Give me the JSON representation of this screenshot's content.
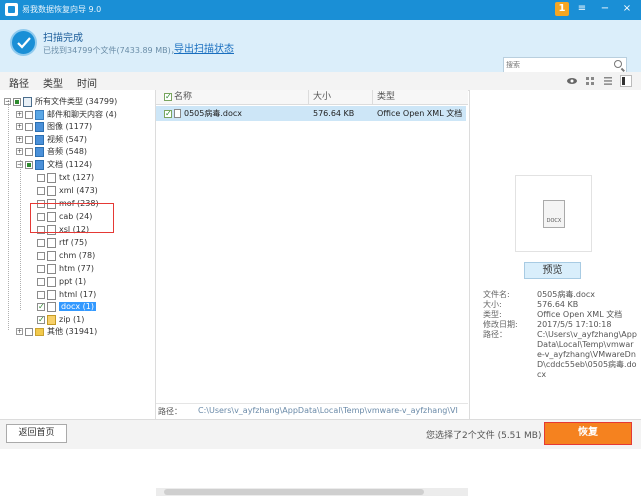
{
  "window": {
    "title": "易我数据恢复向导 9.0",
    "badge": "1"
  },
  "scan": {
    "title": "扫描完成",
    "subtitle": "已找到34799个文件(7433.89 MB)，",
    "export_link": "导出扫描状态",
    "search_placeholder": "搜索"
  },
  "view_tabs": [
    "路径",
    "类型",
    "时间"
  ],
  "tree": [
    {
      "label": "所有文件类型 (34799)",
      "level": 0,
      "expand": "−",
      "check": "partial",
      "icon": "monitor"
    },
    {
      "label": "邮件和聊天内容 (4)",
      "level": 1,
      "expand": "+",
      "check": "none",
      "icon": "mail"
    },
    {
      "label": "图像 (1177)",
      "level": 1,
      "expand": "+",
      "check": "none",
      "icon": "blue"
    },
    {
      "label": "视频 (547)",
      "level": 1,
      "expand": "+",
      "check": "none",
      "icon": "blue"
    },
    {
      "label": "音频 (548)",
      "level": 1,
      "expand": "+",
      "check": "none",
      "icon": "blue"
    },
    {
      "label": "文档 (1124)",
      "level": 1,
      "expand": "−",
      "check": "partial",
      "icon": "blue"
    },
    {
      "label": "txt (127)",
      "level": 2,
      "expand": "",
      "check": "none",
      "icon": "file"
    },
    {
      "label": "xml (473)",
      "level": 2,
      "expand": "",
      "check": "none",
      "icon": "file"
    },
    {
      "label": "mof (238)",
      "level": 2,
      "expand": "",
      "check": "none",
      "icon": "file"
    },
    {
      "label": "cab (24)",
      "level": 2,
      "expand": "",
      "check": "none",
      "icon": "file"
    },
    {
      "label": "xsl (12)",
      "level": 2,
      "expand": "",
      "check": "none",
      "icon": "file"
    },
    {
      "label": "rtf (75)",
      "level": 2,
      "expand": "",
      "check": "none",
      "icon": "file"
    },
    {
      "label": "chm (78)",
      "level": 2,
      "expand": "",
      "check": "none",
      "icon": "file"
    },
    {
      "label": "htm (77)",
      "level": 2,
      "expand": "",
      "check": "none",
      "icon": "file"
    },
    {
      "label": "ppt (1)",
      "level": 2,
      "expand": "",
      "check": "none",
      "icon": "file"
    },
    {
      "label": "html (17)",
      "level": 2,
      "expand": "",
      "check": "none",
      "icon": "file"
    },
    {
      "label": "docx (1)",
      "level": 2,
      "expand": "",
      "check": "checked",
      "icon": "file",
      "selected": true
    },
    {
      "label": "zip (1)",
      "level": 2,
      "expand": "",
      "check": "checked",
      "icon": "zip"
    },
    {
      "label": "其他 (31941)",
      "level": 1,
      "expand": "+",
      "check": "none",
      "icon": "folder"
    }
  ],
  "list": {
    "columns": {
      "name": "名称",
      "size": "大小",
      "type": "类型"
    },
    "rows": [
      {
        "name": "0505病毒.docx",
        "size": "576.64 KB",
        "type": "Office Open XML 文档"
      }
    ],
    "path_label": "路径：",
    "path_value": "C:\\Users\\v_ayfzhang\\AppData\\Local\\Temp\\vmware-v_ayfzhang\\VI"
  },
  "preview": {
    "icon_text": "DOCX",
    "button": "预览",
    "meta": [
      {
        "label": "文件名:",
        "value": "0505病毒.docx"
      },
      {
        "label": "大小:",
        "value": "576.64 KB"
      },
      {
        "label": "类型:",
        "value": "Office Open XML 文档"
      },
      {
        "label": "修改日期:",
        "value": "2017/5/5 17:10:18"
      },
      {
        "label": "路径：",
        "value": "C:\\Users\\v_ayfzhang\\AppData\\Local\\Temp\\vmware-v_ayfzhang\\VMwareDnD\\cddc55eb\\0505病毒.docx"
      }
    ]
  },
  "bottom": {
    "back": "返回首页",
    "selection": "您选择了2个文件 (5.51 MB)",
    "recover": "恢复"
  },
  "colors": {
    "accent": "#1a8fd6",
    "recover": "#f5821f",
    "highlight": "#e53935"
  }
}
